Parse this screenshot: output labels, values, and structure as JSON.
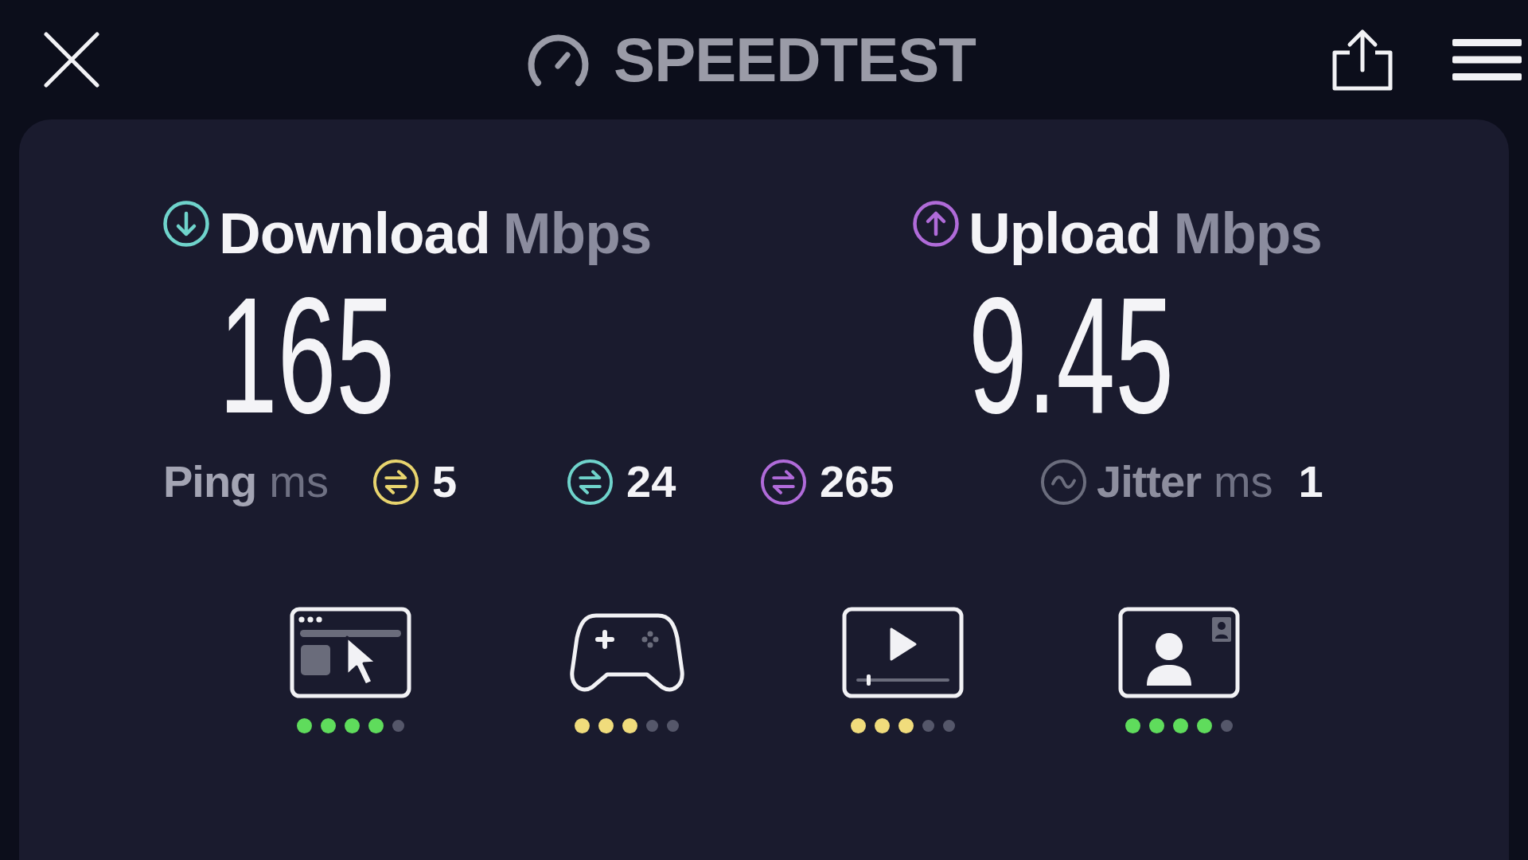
{
  "header": {
    "title": "SPEEDTEST"
  },
  "results": [
    {
      "kind": "download",
      "label": "Download",
      "unit": "Mbps",
      "value": "165",
      "color": "#6fd3cb"
    },
    {
      "kind": "upload",
      "label": "Upload",
      "unit": "Mbps",
      "value": "9.45",
      "color": "#b06bd9"
    }
  ],
  "ping": {
    "label": "Ping",
    "unit": "ms",
    "readings": [
      {
        "value": "5",
        "color": "#e8d46e"
      },
      {
        "value": "24",
        "color": "#6fd3cb"
      },
      {
        "value": "265",
        "color": "#b06bd9"
      }
    ]
  },
  "jitter": {
    "label": "Jitter",
    "unit": "ms",
    "value": "1"
  },
  "quality": [
    {
      "kind": "browsing",
      "stars": 4,
      "color": "#5fdc5c"
    },
    {
      "kind": "gaming",
      "stars": 3,
      "color": "#f0dc7c"
    },
    {
      "kind": "video",
      "stars": 3,
      "color": "#f0dc7c"
    },
    {
      "kind": "video_call",
      "stars": 4,
      "color": "#5fdc5c"
    }
  ]
}
